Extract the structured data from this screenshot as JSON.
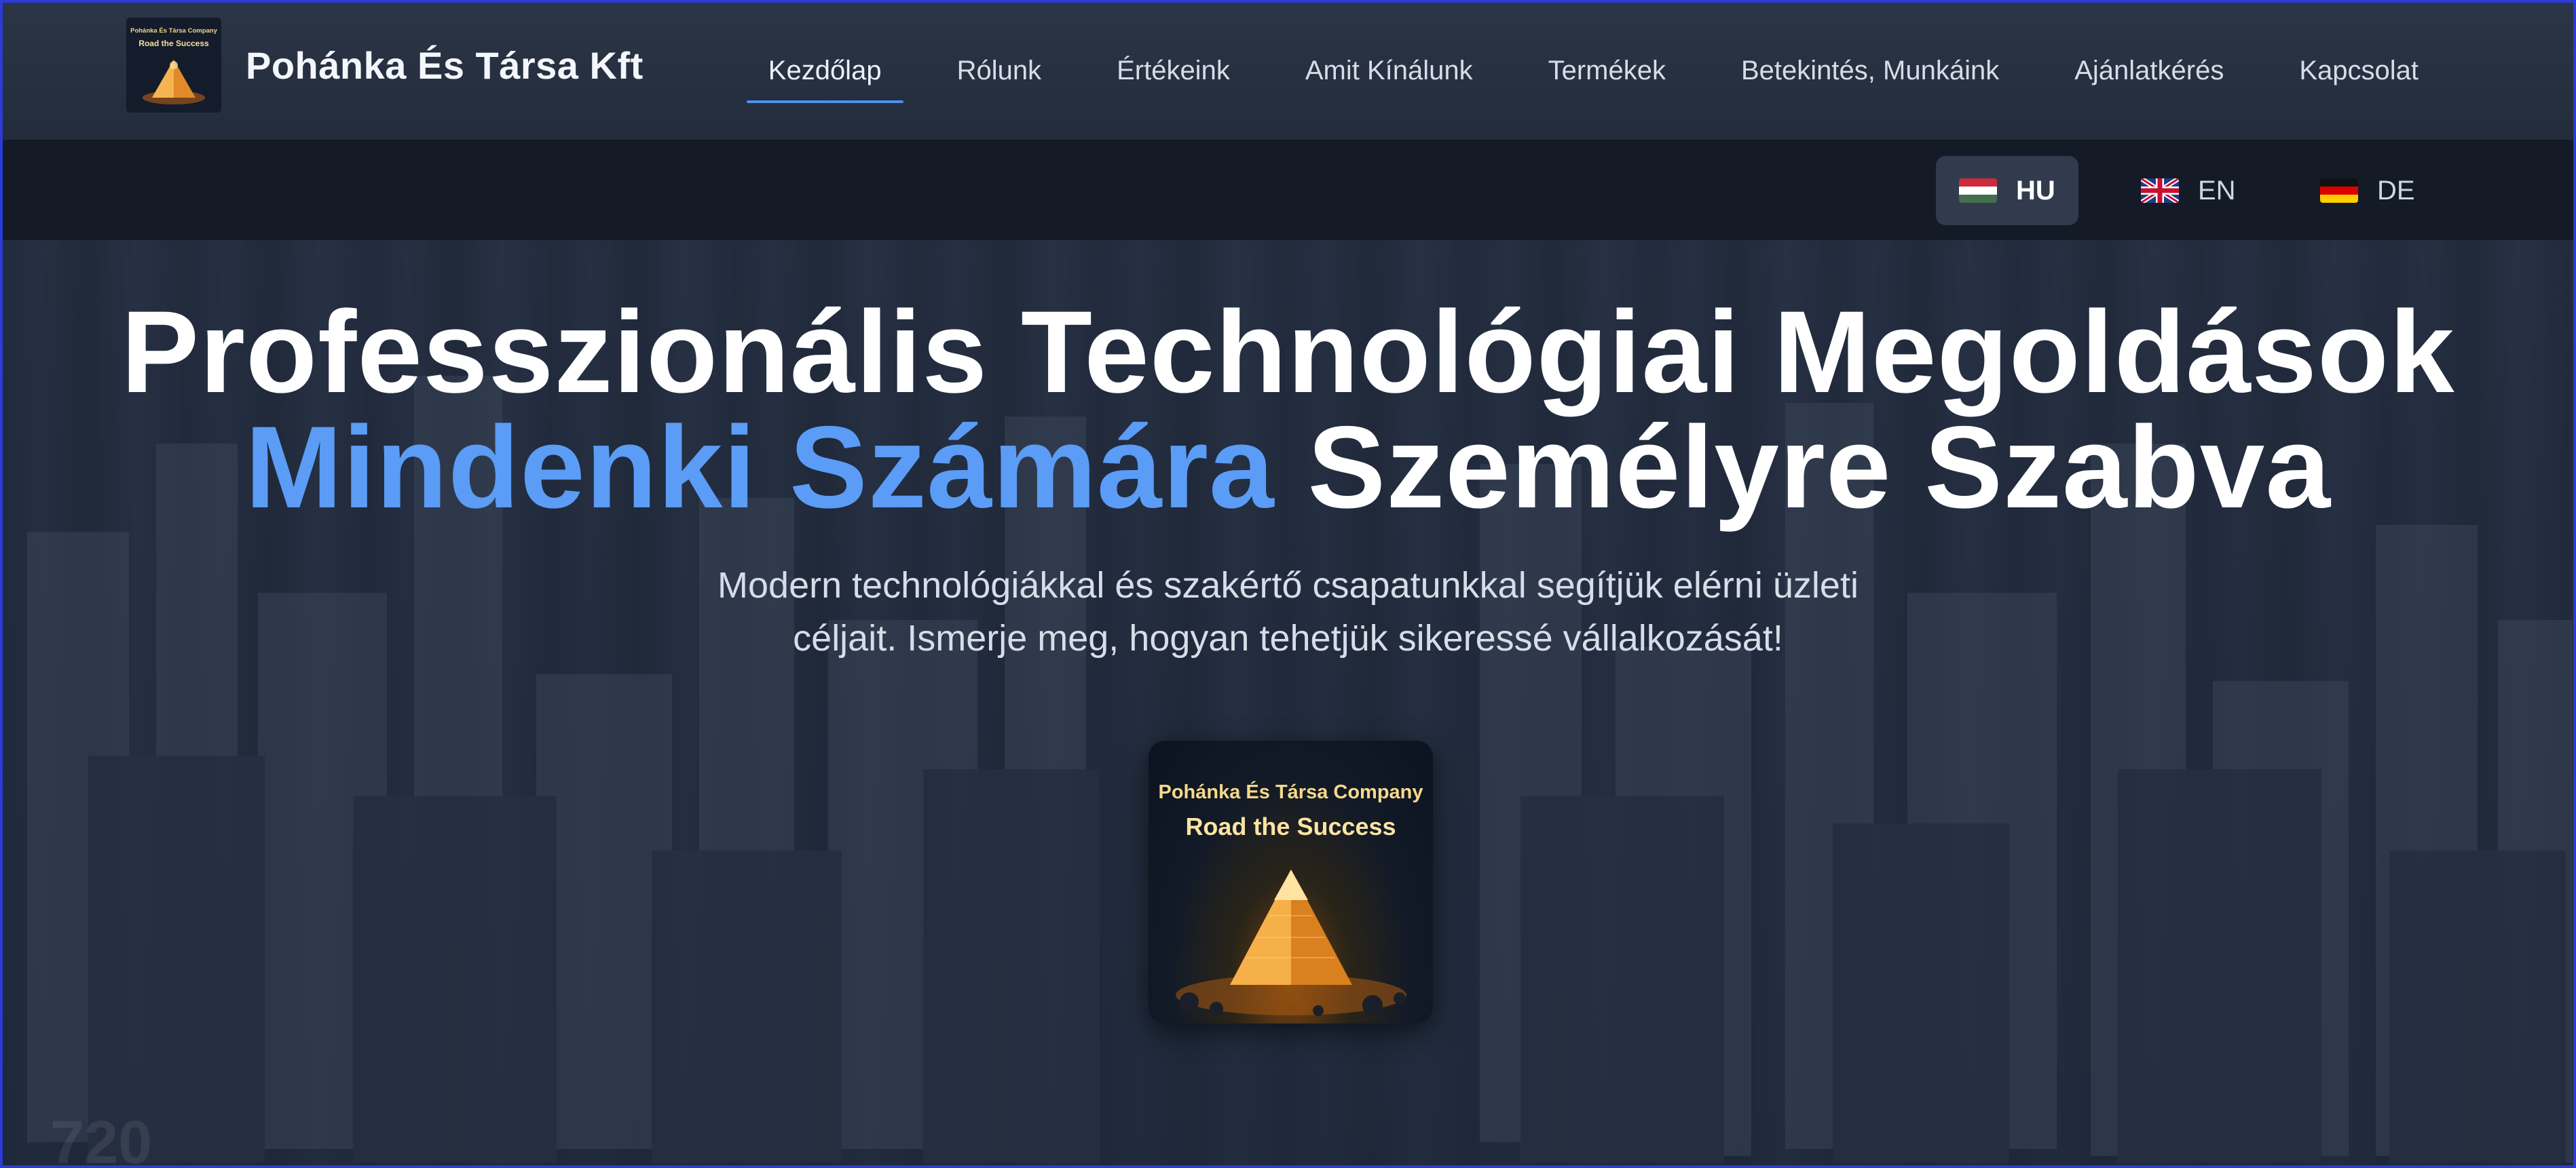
{
  "brand": {
    "name": "Pohánka És Társa Kft",
    "logo_text_line1": "Pohánka És Társa Company",
    "logo_text_line2": "Road the Success"
  },
  "nav": {
    "items": [
      {
        "label": "Kezdőlap",
        "active": true
      },
      {
        "label": "Rólunk",
        "active": false
      },
      {
        "label": "Értékeink",
        "active": false
      },
      {
        "label": "Amit Kínálunk",
        "active": false
      },
      {
        "label": "Termékek",
        "active": false
      },
      {
        "label": "Betekintés, Munkáink",
        "active": false
      },
      {
        "label": "Ajánlatkérés",
        "active": false
      },
      {
        "label": "Kapcsolat",
        "active": false
      }
    ]
  },
  "languages": [
    {
      "code": "HU",
      "flag": "hungary-flag-icon",
      "active": true
    },
    {
      "code": "EN",
      "flag": "uk-flag-icon",
      "active": false
    },
    {
      "code": "DE",
      "flag": "germany-flag-icon",
      "active": false
    }
  ],
  "hero": {
    "title_line1": "Professzionális Technológiai Megoldások",
    "title_line2_accent": "Mindenki Számára",
    "title_line2_rest": " Személyre Szabva",
    "subtitle_line1": "Modern technológiákkal és szakértő csapatunkkal segítjük elérni üzleti",
    "subtitle_line2": "céljait. Ismerje meg, hogyan tehetjük sikeressé vállalkozását!",
    "card_line1": "Pohánka És Társa Company",
    "card_line2": "Road the Success",
    "watermark": "720"
  },
  "colors": {
    "accent": "#5b9cf6",
    "nav_underline": "#4f8ff2",
    "header_bg": "#2b3546",
    "lang_bar_bg": "#141b27",
    "active_lang_bg": "#313b4d"
  }
}
